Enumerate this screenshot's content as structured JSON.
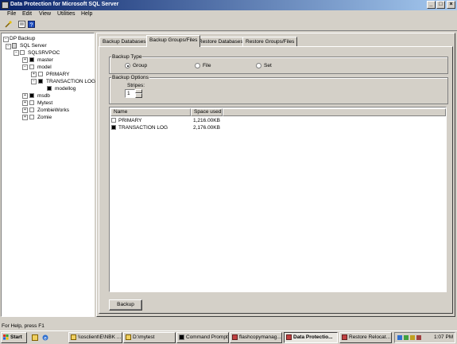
{
  "window": {
    "title": "Data Protection for Microsoft SQL Server"
  },
  "menu": [
    "File",
    "Edit",
    "View",
    "Utilities",
    "Help"
  ],
  "toolbar": {
    "icons": [
      "wizard-icon",
      "properties-icon",
      "help-icon"
    ]
  },
  "tree": {
    "root": "DP Backup",
    "server_group": "SQL Server",
    "server": "SQLSRVPOC",
    "databases": [
      "master",
      "model",
      "msdb",
      "Mytest",
      "ZombieWorks",
      "Zomie"
    ],
    "model_children": [
      "PRIMARY",
      "TRANSACTION LOG"
    ],
    "log_children": [
      "modellog"
    ]
  },
  "tabs": [
    "Backup Databases",
    "Backup Groups/Files",
    "Restore Databases",
    "Restore Groups/Files"
  ],
  "active_tab": "Backup Groups/Files",
  "backup_type": {
    "label": "Backup Type",
    "options": [
      "Group",
      "File",
      "Set"
    ],
    "selected": "Group"
  },
  "backup_options": {
    "label": "Backup Options",
    "stripes_label": "Stripes:",
    "stripes_value": "1"
  },
  "list": {
    "columns": [
      "Name",
      "Space used"
    ],
    "rows": [
      {
        "name": "PRIMARY",
        "space": "1,216.00KB",
        "checked": false
      },
      {
        "name": "TRANSACTION LOG",
        "space": "2,176.00KB",
        "checked": true
      }
    ]
  },
  "backup_button": "Backup",
  "status": "For Help, press F1",
  "taskbar": {
    "start": "Start",
    "buttons": [
      "\\\\osclient\\E\\NBK ...",
      "D:\\mytest",
      "Command Prompt",
      "flashcopymanag...",
      "Data Protectio...",
      "Restore Relocat..."
    ],
    "active": "Data Protectio...",
    "clock": "1:07 PM"
  },
  "colors": {
    "title_start": "#0a246a",
    "title_end": "#a6caf0",
    "face": "#d4d0c8"
  }
}
